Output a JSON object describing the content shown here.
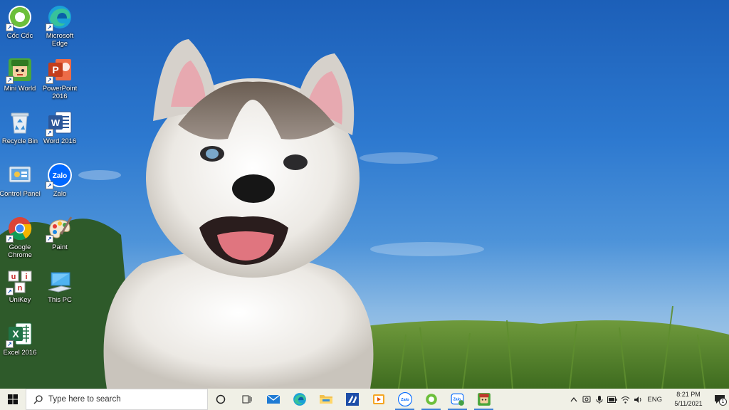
{
  "desktop": {
    "icons": [
      {
        "label": "Cốc Cốc",
        "icon": "coccoc-browser-icon"
      },
      {
        "label": "Microsoft Edge",
        "icon": "edge-icon"
      },
      {
        "label": "Mini World",
        "icon": "mini-world-icon"
      },
      {
        "label": "PowerPoint 2016",
        "icon": "powerpoint-icon"
      },
      {
        "label": "Recycle Bin",
        "icon": "recycle-bin-icon"
      },
      {
        "label": "Word 2016",
        "icon": "word-icon"
      },
      {
        "label": "Control Panel",
        "icon": "control-panel-icon"
      },
      {
        "label": "Zalo",
        "icon": "zalo-icon",
        "icon_text": "Zalo"
      },
      {
        "label": "Google Chrome",
        "icon": "chrome-icon"
      },
      {
        "label": "Paint",
        "icon": "paint-icon"
      },
      {
        "label": "UniKey",
        "icon": "unikey-icon",
        "icon_letters": [
          "u",
          "i",
          "n"
        ]
      },
      {
        "label": "This PC",
        "icon": "this-pc-icon"
      },
      {
        "label": "Excel 2016",
        "icon": "excel-icon"
      }
    ],
    "ppt_letter": "P",
    "word_letter": "W",
    "excel_letter": "X"
  },
  "taskbar": {
    "search_placeholder": "Type here to search",
    "pinned": [
      {
        "name": "cortana-icon"
      },
      {
        "name": "task-view-icon"
      },
      {
        "name": "mail-icon"
      },
      {
        "name": "edge-icon"
      },
      {
        "name": "file-explorer-icon"
      },
      {
        "name": "app-icon"
      },
      {
        "name": "media-player-icon"
      },
      {
        "name": "zalo-icon",
        "active": true
      },
      {
        "name": "coccoc-browser-icon",
        "active": true
      },
      {
        "name": "zalo-icon",
        "active": true
      },
      {
        "name": "mini-world-icon",
        "active": true
      }
    ],
    "tray": {
      "language": "ENG",
      "time": "8:21 PM",
      "date": "5/11/2021",
      "notification_count": "1"
    }
  },
  "colors": {
    "taskbar": "#f0f0e6",
    "accent": "#3b7fd6",
    "sky": "#2c78cf"
  }
}
